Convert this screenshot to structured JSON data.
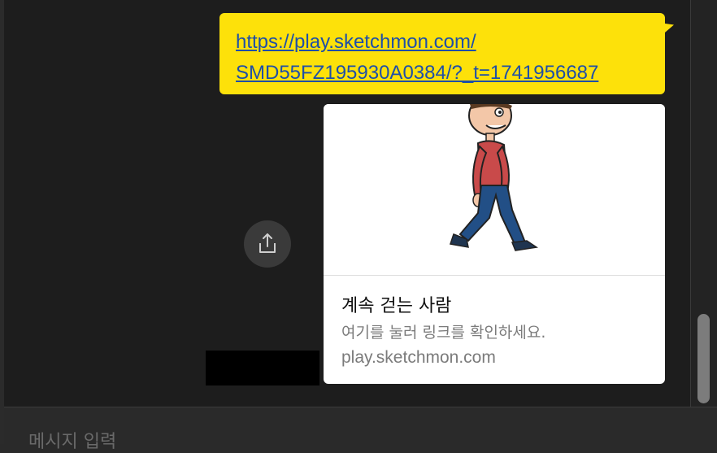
{
  "message": {
    "link_line1": "https://play.sketchmon.com/",
    "link_line2": "SMD55FZ195930A0384/?_t=1741956687"
  },
  "preview_card": {
    "title": "계속 걷는 사람",
    "description": "여기를 눌러 링크를 확인하세요.",
    "domain": "play.sketchmon.com",
    "image": "walking-cartoon-man"
  },
  "input": {
    "placeholder": "메시지 입력"
  },
  "colors": {
    "bubble": "#fde10a",
    "link": "#1e4fa8",
    "chat_background": "#1d1d1d"
  },
  "icons": {
    "share": "share-upload-icon"
  }
}
